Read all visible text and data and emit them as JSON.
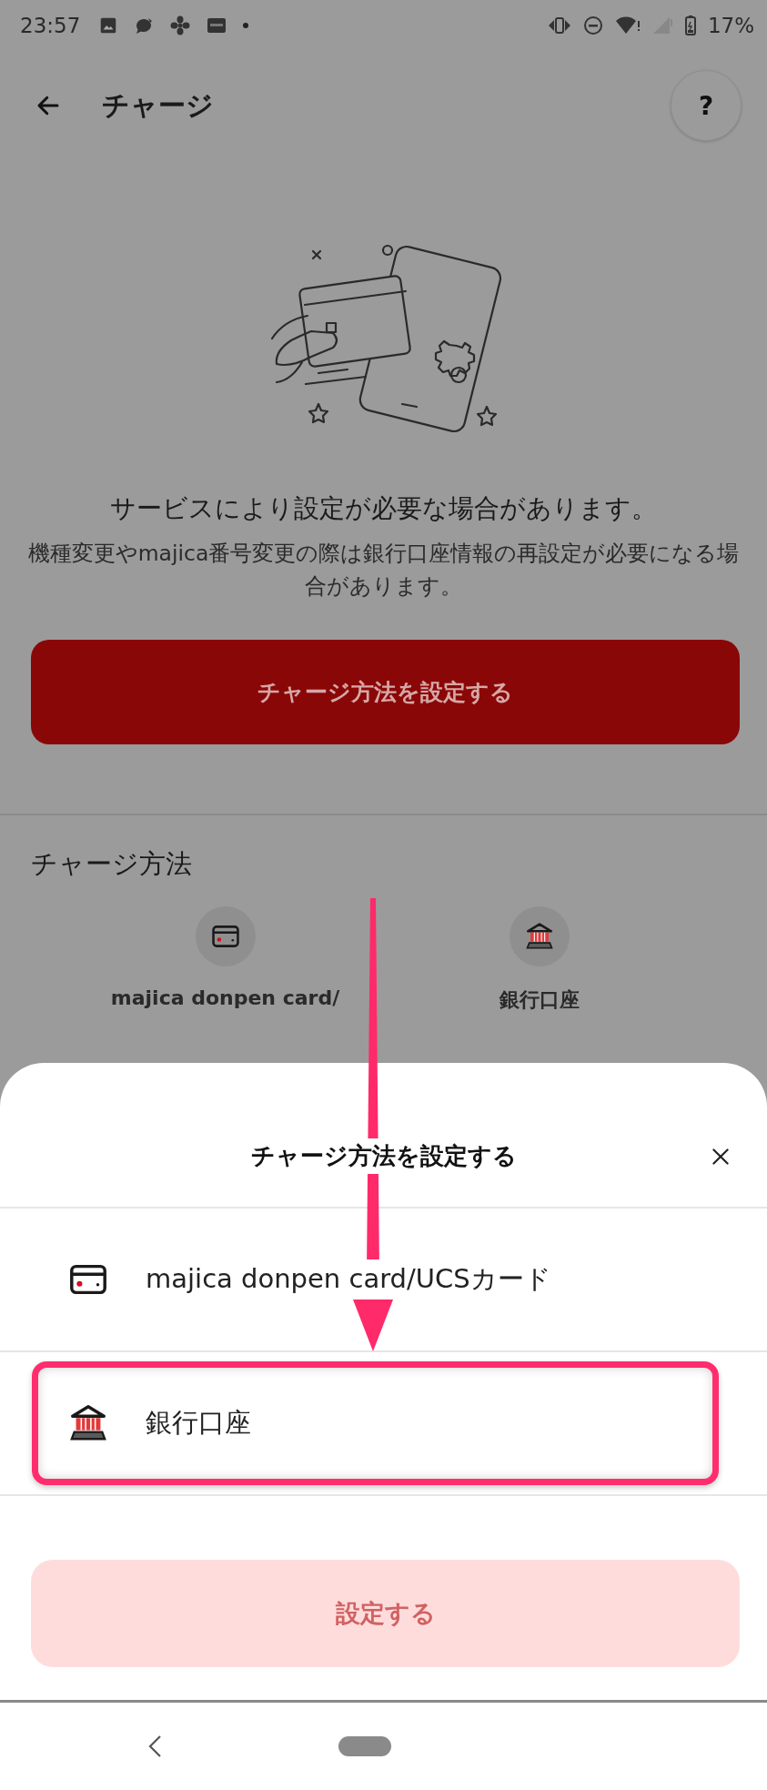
{
  "status_bar": {
    "time": "23:57",
    "battery": "17%"
  },
  "app_bar": {
    "title": "チャージ",
    "help": "?"
  },
  "notice": {
    "headline": "サービスにより設定が必要な場合があります。",
    "body": "機種変更やmajica番号変更の際は銀行口座情報の再設定が必要になる場合があります。"
  },
  "setup_button": {
    "label": "チャージ方法を設定する"
  },
  "methods_section": {
    "title": "チャージ方法",
    "methods": [
      {
        "kind": "card",
        "label": "majica donpen card/"
      },
      {
        "kind": "bank",
        "label": "銀行口座"
      }
    ]
  },
  "sheet": {
    "title": "チャージ方法を設定する",
    "options": [
      {
        "kind": "card",
        "label": "majica donpen card/UCSカード",
        "selected": false
      },
      {
        "kind": "bank",
        "label": "銀行口座",
        "selected": true
      }
    ],
    "confirm_button": {
      "label": "設定する",
      "disabled": true
    }
  },
  "annotations": [
    {
      "kind": "arrow"
    }
  ]
}
